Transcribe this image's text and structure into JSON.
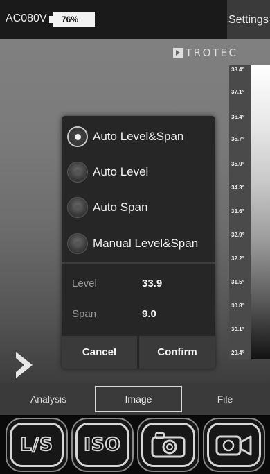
{
  "status_bar": {
    "device_label": "AC080V",
    "battery_percent": "76%",
    "settings_label": "Settings"
  },
  "branding": {
    "logo_text": "TROTEC"
  },
  "temperature_scale": {
    "labels": [
      "38.4°",
      "37.1°",
      "36.4°",
      "35.7°",
      "35.0°",
      "34.3°",
      "33.6°",
      "32.9°",
      "32.2°",
      "31.5°",
      "30.8°",
      "30.1°",
      "29.4°"
    ]
  },
  "dialog": {
    "options": [
      {
        "label": "Auto Level&Span",
        "checked": true
      },
      {
        "label": "Auto Level",
        "checked": false
      },
      {
        "label": "Auto Span",
        "checked": false
      },
      {
        "label": "Manual Level&Span",
        "checked": false
      }
    ],
    "level": {
      "label": "Level",
      "value": "33.9"
    },
    "span": {
      "label": "Span",
      "value": "9.0"
    },
    "cancel_label": "Cancel",
    "confirm_label": "Confirm"
  },
  "tabs": {
    "analysis": "Analysis",
    "image": "Image",
    "file": "File",
    "active": "image"
  },
  "actions": {
    "items": [
      "level-span",
      "iso",
      "photo-camera",
      "video-camera"
    ],
    "level_span_text": "L/S",
    "iso_text": "ISO"
  },
  "colors": {
    "topbar": "#1a1a1a",
    "dialog": "#262626",
    "tabs": "#3a3a3a"
  }
}
